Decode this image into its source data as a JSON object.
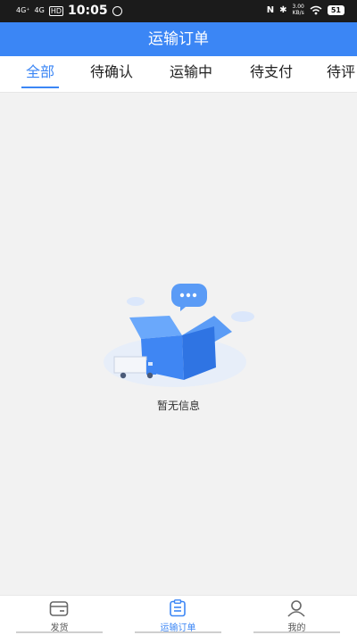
{
  "status_bar": {
    "signal_1": "4G⁺",
    "signal_2": "4G",
    "hd": "HD",
    "time": "10:05",
    "speed_value": "3.00",
    "speed_unit": "KB/s",
    "battery": "51"
  },
  "header": {
    "title": "运输订单"
  },
  "tabs": [
    {
      "label": "全部"
    },
    {
      "label": "待确认"
    },
    {
      "label": "运输中"
    },
    {
      "label": "待支付"
    },
    {
      "label": "待评"
    }
  ],
  "empty_state": {
    "text": "暂无信息"
  },
  "bottom_nav": {
    "items": [
      {
        "label": "发货",
        "icon": "wallet-icon"
      },
      {
        "label": "运输订单",
        "icon": "clipboard-icon"
      },
      {
        "label": "我的",
        "icon": "user-icon"
      }
    ]
  },
  "colors": {
    "primary": "#3b86f5",
    "background": "#f2f2f2"
  }
}
